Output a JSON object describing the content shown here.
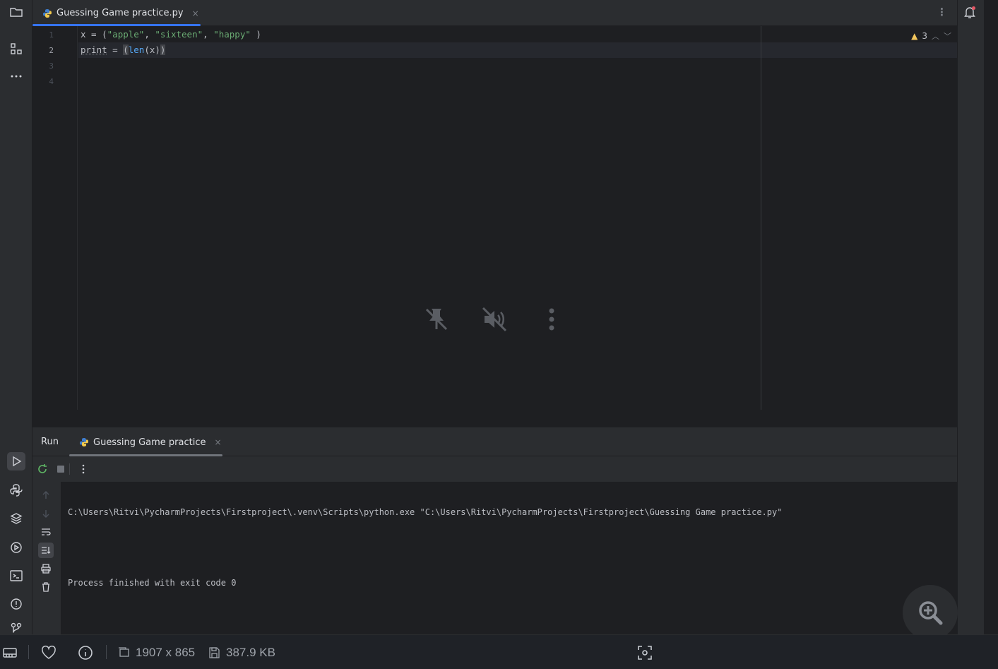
{
  "editor": {
    "tab": {
      "label": "Guessing Game practice.py",
      "close": "×"
    },
    "line_numbers": [
      "1",
      "2",
      "3",
      "4"
    ],
    "code": {
      "line1": {
        "var": "x",
        "eq": " = (",
        "s1": "\"apple\"",
        "c1": ", ",
        "s2": "\"sixteen\"",
        "c2": ", ",
        "s3": "\"happy\"",
        "end": " )"
      },
      "line2": {
        "kw": "print",
        "eq": " = ",
        "open": "(",
        "fn": "len",
        "args": "(x)",
        "close": ")"
      }
    },
    "inspections": {
      "warnings": "3"
    }
  },
  "run": {
    "title": "Run",
    "tab": {
      "label": "Guessing Game practice",
      "close": "×"
    },
    "console": {
      "command": "C:\\Users\\Ritvi\\PycharmProjects\\Firstproject\\.venv\\Scripts\\python.exe \"C:\\Users\\Ritvi\\PycharmProjects\\Firstproject\\Guessing Game practice.py\"",
      "exit": "Process finished with exit code 0"
    }
  },
  "viewer": {
    "dimensions": "1907 x 865",
    "file_size": "387.9 KB"
  },
  "colors": {
    "accent": "#3574f0",
    "string": "#6aab73",
    "function": "#56a8f5",
    "warning": "#f2c55c"
  }
}
